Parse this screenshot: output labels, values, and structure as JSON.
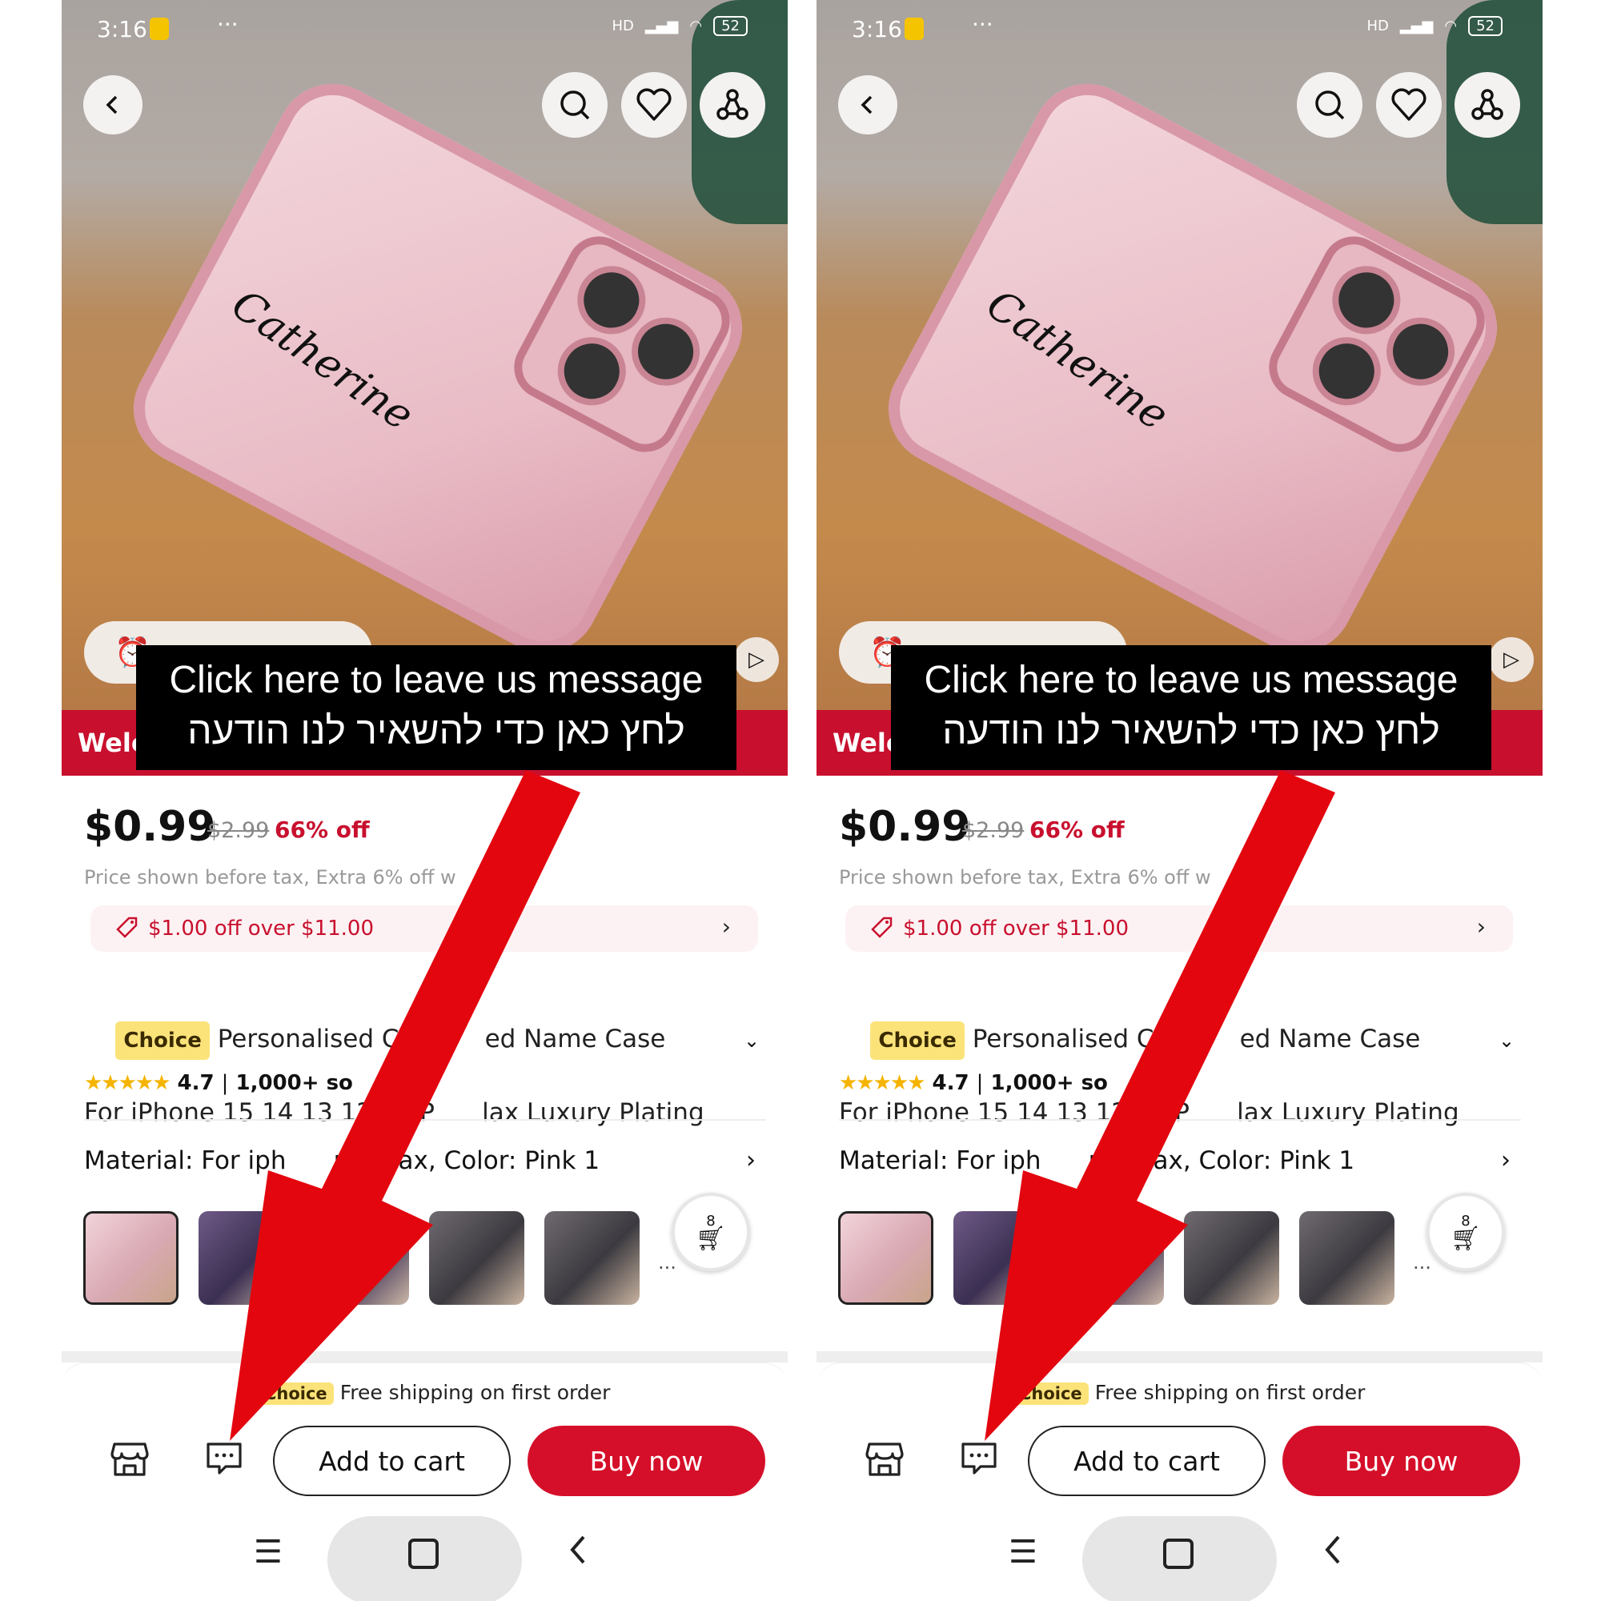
{
  "status_bar": {
    "time": "3:16",
    "more": "···",
    "network": "HD",
    "wifi_badge": "6",
    "battery": "52"
  },
  "top_actions": {
    "back_icon": "chevron-left-icon",
    "search_icon": "search-icon",
    "wishlist_icon": "heart-icon",
    "share_icon": "share-icon"
  },
  "product_image": {
    "engraving": "Catherine"
  },
  "banner": {
    "text": "Welc"
  },
  "overlay": {
    "line1": "Click here to leave us message",
    "line2": "לחץ כאן כדי להשאיר לנו הודעה"
  },
  "price": {
    "current": "$0.99",
    "original": "$2.99",
    "discount": "66% off",
    "note": "Price shown before tax, Extra 6% off w        ns"
  },
  "coupon": {
    "text": "$1.00 off over $11.00"
  },
  "product": {
    "badge": "Choice",
    "title_line1": "Personalised Cust      ed Name Case",
    "title_line2": "For iPhone 15 14 13 12 11 P      lax Luxury Plating",
    "stars": "★★★★★",
    "rating": "4.7",
    "sold": "1,000+ so"
  },
  "variant": {
    "text": "Material: For iph      promax, Color: Pink 1",
    "more": "···"
  },
  "cart": {
    "count": "8"
  },
  "shipping": {
    "badge": "Choice",
    "text": "Free shipping on first order"
  },
  "actions": {
    "add_to_cart": "Add to cart",
    "buy_now": "Buy now"
  },
  "colors": {
    "brand_red": "#d50f29",
    "choice_yellow": "#fbe37a",
    "arrow_red": "#e3060f"
  }
}
